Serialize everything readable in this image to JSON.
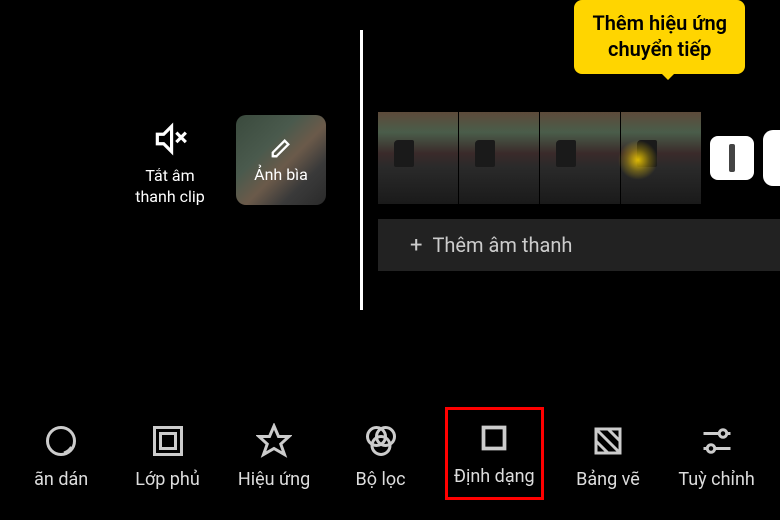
{
  "tooltip": {
    "line1": "Thêm hiệu ứng",
    "line2": "chuyển tiếp"
  },
  "mute": {
    "label_line1": "Tắt âm",
    "label_line2": "thanh clip"
  },
  "cover": {
    "label": "Ảnh bìa"
  },
  "audio": {
    "add_label": "Thêm âm thanh"
  },
  "toolbar": {
    "sticker": "ãn dán",
    "overlay": "Lớp phủ",
    "effect": "Hiệu ứng",
    "filter": "Bộ lọc",
    "format": "Định dạng",
    "canvas": "Bảng vẽ",
    "adjust": "Tuỳ chỉnh"
  },
  "colors": {
    "accent": "#ffd500",
    "highlight": "#ff0000"
  }
}
